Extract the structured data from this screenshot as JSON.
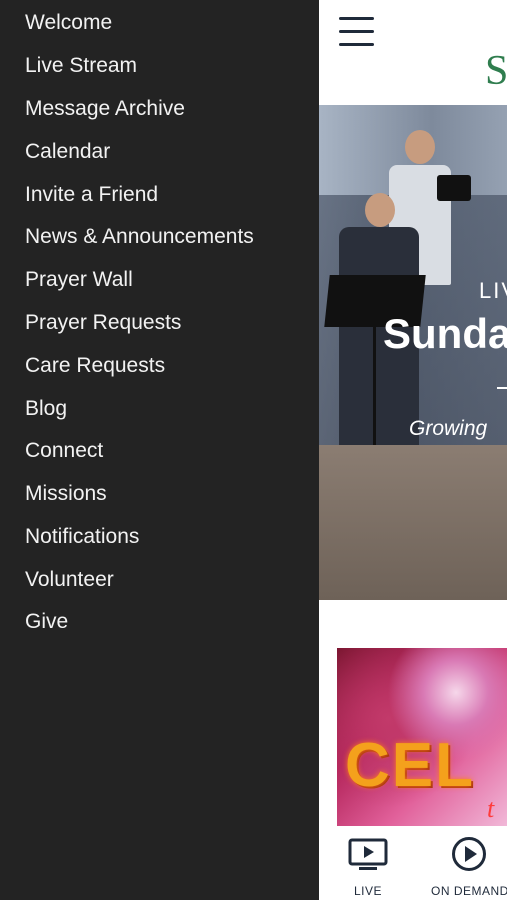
{
  "drawer": {
    "items": [
      {
        "label": "Welcome"
      },
      {
        "label": "Live Stream"
      },
      {
        "label": "Message Archive"
      },
      {
        "label": "Calendar"
      },
      {
        "label": "Invite a Friend"
      },
      {
        "label": "News & Announcements"
      },
      {
        "label": "Prayer Wall"
      },
      {
        "label": "Prayer Requests"
      },
      {
        "label": "Care Requests"
      },
      {
        "label": "Blog"
      },
      {
        "label": "Connect"
      },
      {
        "label": "Missions"
      },
      {
        "label": "Notifications"
      },
      {
        "label": "Volunteer"
      },
      {
        "label": "Give"
      }
    ]
  },
  "header": {
    "menu_icon": "hamburger-menu-icon",
    "logo_fragment": "S"
  },
  "hero": {
    "kicker": "LIV",
    "title": "Sunda",
    "subtitle": "Growing"
  },
  "card": {
    "title_fragment": "CEL",
    "sub_fragment": "t"
  },
  "tabbar": {
    "tabs": [
      {
        "label": "LIVE",
        "icon": "live-tv-icon"
      },
      {
        "label": "ON DEMAND",
        "icon": "play-circle-icon"
      }
    ]
  },
  "colors": {
    "drawer_bg": "#232323",
    "drawer_text": "#f2f2f2",
    "icon_navy": "#1f2a3a",
    "logo_green": "#2f7d4e"
  }
}
